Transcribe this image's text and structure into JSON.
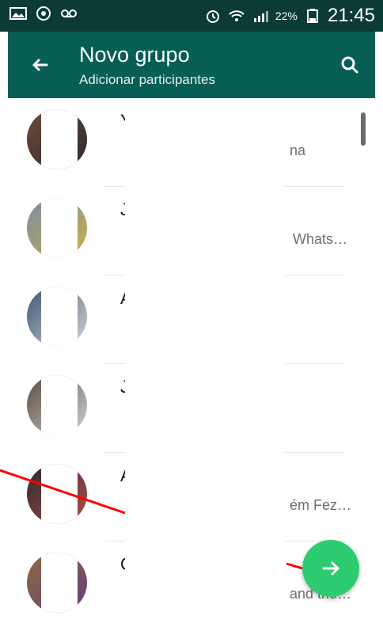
{
  "status_bar": {
    "battery": "22%",
    "time": "21:45",
    "icons": [
      "picture-icon",
      "whatsapp-icon",
      "voicemail-icon",
      "alarm-icon",
      "wifi-icon",
      "signal-icon",
      "battery-icon"
    ]
  },
  "appbar": {
    "title": "Novo grupo",
    "subtitle": "Adicionar participantes",
    "colors": {
      "appbar": "#075e54",
      "statusbar": "#0b3b34",
      "fab": "#2ecc71"
    }
  },
  "contacts": [
    {
      "name": "Y",
      "status_visible": "na",
      "avatar_colors": [
        "#6d4b3a",
        "#2f2a2a"
      ]
    },
    {
      "name": "J",
      "status_visible": "Whats…",
      "avatar_colors": [
        "#7a8ca2",
        "#cbb04c"
      ]
    },
    {
      "name": "A",
      "status_visible": "",
      "avatar_colors": [
        "#3b5674",
        "#d3d3d3"
      ]
    },
    {
      "name": "J",
      "status_visible": "",
      "avatar_colors": [
        "#5a4a3c",
        "#cfd2d3"
      ]
    },
    {
      "name": "A",
      "status_visible": "ém Fez…",
      "avatar_colors": [
        "#2a2a2a",
        "#b44d4d"
      ]
    },
    {
      "name": "C",
      "status_visible": "and the…",
      "avatar_colors": [
        "#8c6a3f",
        "#6a3d7a"
      ]
    }
  ]
}
